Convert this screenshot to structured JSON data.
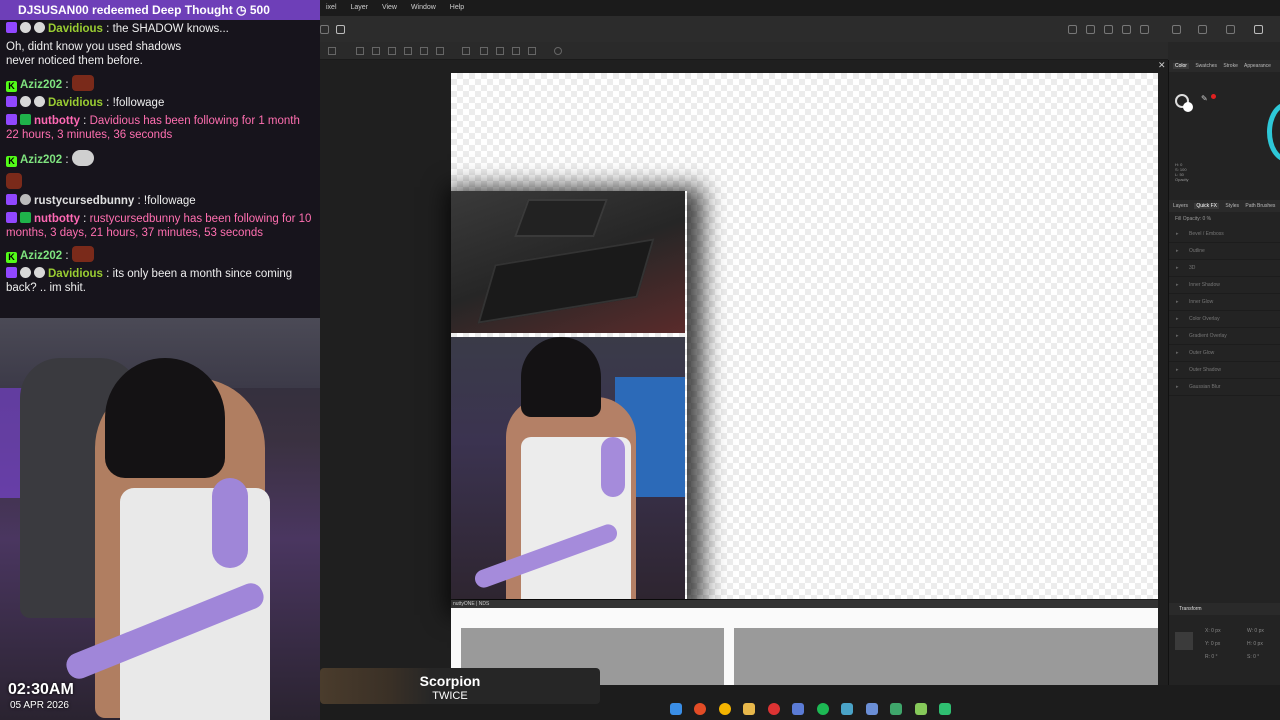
{
  "chat": {
    "redeem": "DJSUSAN00 redeemed Deep Thought ◷ 500",
    "messages": [
      {
        "user": "Davidious",
        "sep": " : ",
        "text": "the SHADOW knows..."
      },
      {
        "user": "",
        "sep": "",
        "text": "Oh, didnt know you used shadows never noticed them before."
      },
      {
        "user": "Aziz202",
        "sep": " : ",
        "text": ""
      },
      {
        "user": "Davidious",
        "sep": " : ",
        "text": "!followage"
      },
      {
        "user": "nutbotty",
        "sep": " : ",
        "text": "Davidious has been following for 1 month 22 hours, 3 minutes, 36 seconds"
      },
      {
        "user": "Aziz202",
        "sep": " : ",
        "text": ""
      },
      {
        "user": "rustycursedbunny",
        "sep": " : ",
        "text": "!followage"
      },
      {
        "user": "nutbotty",
        "sep": " : ",
        "text": "rustycursedbunny has been following for 10 months, 3 days, 21 hours, 37 minutes, 53 seconds"
      },
      {
        "user": "Aziz202",
        "sep": " : ",
        "text": ""
      },
      {
        "user": "Davidious",
        "sep": " : ",
        "text": "its only been a month since coming back? .. im shit."
      }
    ]
  },
  "overlay": {
    "time": "02:30AM",
    "date": "05 APR 2026"
  },
  "app": {
    "menu": [
      "ixel",
      "Layer",
      "View",
      "Window",
      "Help"
    ],
    "doc2_tab": "nuttyONE | NDS",
    "color_tabs": [
      "Color",
      "Swatches",
      "Stroke",
      "Appearance"
    ],
    "layer_tabs": [
      "Layers",
      "Quick FX",
      "Styles",
      "Path Brushes"
    ],
    "fill_opacity": "Fill Opacity:  0 %",
    "hsl": [
      "H: 0",
      "S: 100",
      "L: 50",
      "Opacity"
    ],
    "fx": [
      "Bevel / Emboss",
      "Outline",
      "3D",
      "Inner Shadow",
      "Inner Glow",
      "Color Overlay",
      "Gradient Overlay",
      "Outer Glow",
      "Outer Shadow",
      "Gaussian Blur"
    ],
    "transform": {
      "header": "Transform",
      "x": "X:   0 px",
      "y": "Y:   0 px",
      "r": "R:   0 °",
      "w": "W:   0 px",
      "h": "H:   0 px",
      "s": "S:   0 °"
    }
  },
  "media": {
    "title": "Scorpion",
    "artist": "TWICE"
  },
  "colors": {
    "redeem_bg": "#6e3fb8",
    "davidious": "#9acd32",
    "nutbotty": "#ff69b4",
    "aziz": "#7fe37f"
  }
}
